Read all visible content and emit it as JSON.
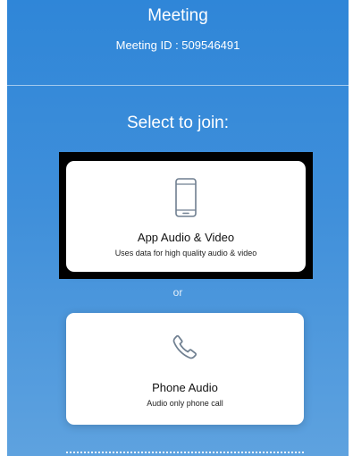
{
  "header": {
    "title": "Meeting",
    "meeting_id": "Meeting ID : 509546491"
  },
  "prompt": "Select to join:",
  "options": [
    {
      "title": "App Audio & Video",
      "subtitle": "Uses data for high quality audio & video",
      "icon": "smartphone-icon"
    },
    {
      "title": "Phone Audio",
      "subtitle": "Audio only phone call",
      "icon": "phone-handset-icon"
    }
  ],
  "separator": "or",
  "colors": {
    "background": "#3a8cd9",
    "card": "#ffffff",
    "highlight_border": "#000000",
    "icon": "#6f7f90"
  }
}
